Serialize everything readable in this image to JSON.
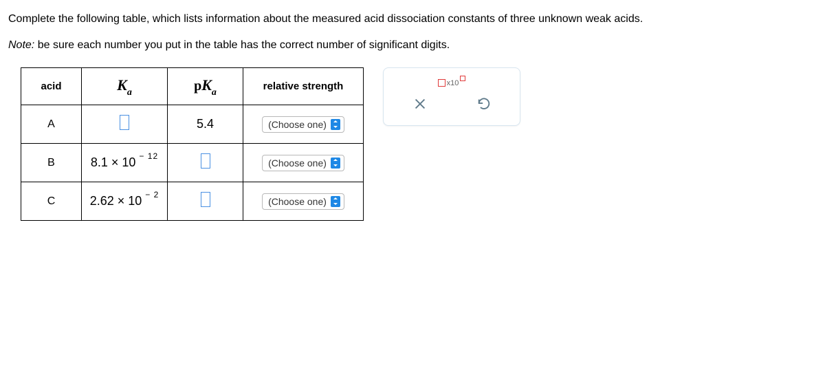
{
  "instructions": {
    "line1": "Complete the following table, which lists information about the measured acid dissociation constants of three unknown weak acids.",
    "note_label": "Note:",
    "note_body": " be sure each number you put in the table has the correct number of significant digits."
  },
  "table": {
    "headers": {
      "acid": "acid",
      "ka_sym": "K",
      "ka_sub": "a",
      "pka_pref": "p",
      "rel": "relative strength"
    },
    "rows": [
      {
        "acid": "A",
        "ka_base": "",
        "ka_exp": "",
        "pka": "5.4",
        "choose": "(Choose one)"
      },
      {
        "acid": "B",
        "ka_base": "8.1  ×  10",
        "ka_exp": "− 12",
        "pka": "",
        "choose": "(Choose one)"
      },
      {
        "acid": "C",
        "ka_base": "2.62  ×  10",
        "ka_exp": "− 2",
        "pka": "",
        "choose": "(Choose one)"
      }
    ]
  },
  "toolbox": {
    "x10": "x10"
  }
}
